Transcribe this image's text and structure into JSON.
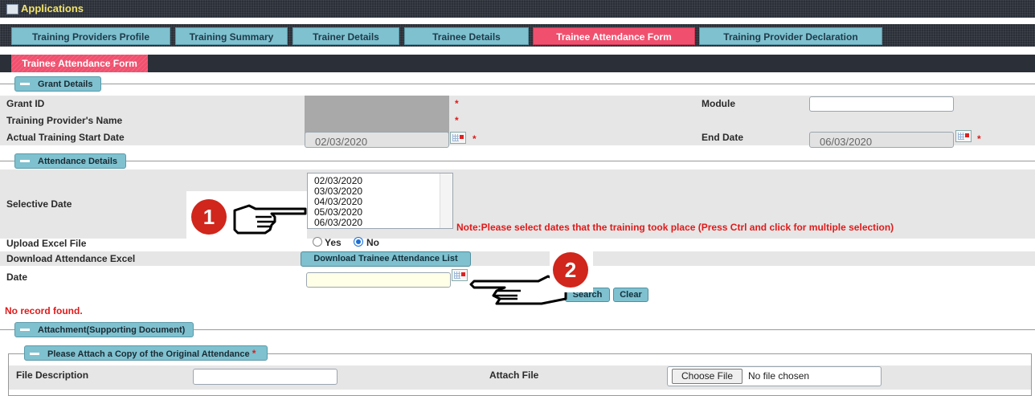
{
  "app": {
    "title": "Applications"
  },
  "tabs": [
    {
      "label": "Training Providers Profile"
    },
    {
      "label": "Training Summary"
    },
    {
      "label": "Trainer Details"
    },
    {
      "label": "Trainee Details"
    },
    {
      "label": "Trainee Attendance Form",
      "active": true
    },
    {
      "label": "Training Provider Declaration"
    }
  ],
  "subtab": {
    "label": "Trainee Attendance Form"
  },
  "grant": {
    "header": "Grant Details",
    "grant_id_label": "Grant ID",
    "provider_name_label": "Training Provider's Name",
    "start_date_label": "Actual Training Start Date",
    "start_date_value": "02/03/2020",
    "module_label": "Module",
    "module_value": "",
    "end_date_label": "End Date",
    "end_date_value": "06/03/2020",
    "required_mark": "*"
  },
  "attendance": {
    "header": "Attendance Details",
    "selective_date_label": "Selective Date",
    "dates": [
      "02/03/2020",
      "03/03/2020",
      "04/03/2020",
      "05/03/2020",
      "06/03/2020"
    ],
    "note": "Note:Please select dates that the training took place (Press Ctrl and click for multiple selection)",
    "upload_label": "Upload Excel File",
    "yes_label": "Yes",
    "no_label": "No",
    "upload_selected": "No",
    "download_label": "Download Attendance Excel",
    "download_button": "Download Trainee Attendance List",
    "date_label": "Date",
    "date_value": "",
    "search_button": "Search",
    "clear_button": "Clear",
    "no_record": "No record found."
  },
  "attachment": {
    "header": "Attachment(Supporting Document)",
    "subheader": "Please Attach a Copy of the Original Attendance",
    "file_description_label": "File Description",
    "file_description_value": "",
    "attach_file_label": "Attach File",
    "choose_file_button": "Choose File",
    "no_file_text": "No file chosen"
  },
  "annotations": {
    "step1": "1",
    "step2": "2"
  },
  "colors": {
    "tab": "#7fc1cf",
    "active_tab": "#f0506e",
    "required": "#e01a1a",
    "dark_bar": "#2a2f38"
  }
}
